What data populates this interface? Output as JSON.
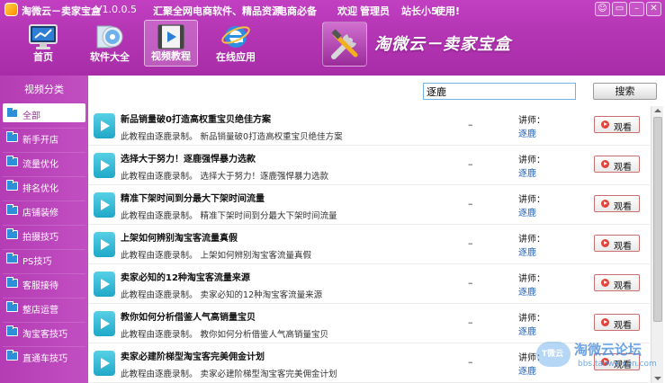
{
  "titlebar": {
    "app_name": "淘微云－卖家宝盒",
    "version": "V1.0.0.5",
    "slogan": "汇聚全网电商软件、精品资源",
    "slogan2": "电商必备",
    "welcome": "欢迎",
    "user": "管理员",
    "member": "站长小5",
    "use": "使用!",
    "buttons": [
      "☺",
      "▭",
      "–",
      "✕"
    ]
  },
  "nav": [
    {
      "label": "首页"
    },
    {
      "label": "软件大全"
    },
    {
      "label": "视频教程",
      "active": true
    },
    {
      "label": "在线应用"
    }
  ],
  "banner": {
    "title": "淘微云－卖家宝盒"
  },
  "sidebar": {
    "title": "视频分类",
    "items": [
      {
        "label": "全部",
        "active": true
      },
      {
        "label": "新手开店"
      },
      {
        "label": "流量优化"
      },
      {
        "label": "排名优化"
      },
      {
        "label": "店铺装修"
      },
      {
        "label": "拍摄技巧"
      },
      {
        "label": "PS技巧"
      },
      {
        "label": "客服接待"
      },
      {
        "label": "整店运营"
      },
      {
        "label": "淘宝客技巧"
      },
      {
        "label": "直通车技巧"
      }
    ]
  },
  "search": {
    "value": "逐鹿",
    "button": "搜索"
  },
  "videos": [
    {
      "title": "新品销量破0打造高权重宝贝绝佳方案",
      "desc": "此教程由逐鹿录制。 新品销量破0打造高权重宝贝绝佳方案",
      "dash": "–",
      "lecturer_label": "讲师：",
      "lecturer": "逐鹿",
      "watch": "观看"
    },
    {
      "title": "选择大于努力！逐鹿强悍暴力选款",
      "desc": "此教程由逐鹿录制。 选择大于努力！逐鹿强悍暴力选款",
      "dash": "–",
      "lecturer_label": "讲师：",
      "lecturer": "逐鹿",
      "watch": "观看"
    },
    {
      "title": "精准下架时间到分最大下架时间流量",
      "desc": "此教程由逐鹿录制。 精准下架时间到分最大下架时间流量",
      "dash": "–",
      "lecturer_label": "讲师：",
      "lecturer": "逐鹿",
      "watch": "观看"
    },
    {
      "title": "上架如何辨别淘宝客流量真假",
      "desc": "此教程由逐鹿录制。 上架如何辨别淘宝客流量真假",
      "dash": "–",
      "lecturer_label": "讲师：",
      "lecturer": "逐鹿",
      "watch": "观看"
    },
    {
      "title": "卖家必知的12种淘宝客流量来源",
      "desc": "此教程由逐鹿录制。 卖家必知的12种淘宝客流量来源",
      "dash": "–",
      "lecturer_label": "讲师：",
      "lecturer": "逐鹿",
      "watch": "观看"
    },
    {
      "title": "教你如何分析借鉴人气高销量宝贝",
      "desc": "此教程由逐鹿录制。 教你如何分析借鉴人气高销量宝贝",
      "dash": "–",
      "lecturer_label": "讲师：",
      "lecturer": "逐鹿",
      "watch": "观看"
    },
    {
      "title": "卖家必建阶梯型淘宝客完美佣金计划",
      "desc": "此教程由逐鹿录制。 卖家必建阶梯型淘宝客完美佣金计划",
      "dash": "–",
      "lecturer_label": "讲师：",
      "lecturer": "逐鹿",
      "watch": "观看"
    }
  ],
  "watermark": {
    "logo": "T微云",
    "text": "淘微云论坛",
    "url": "bbs.taoweiyun.com"
  },
  "colors": {
    "header": "#b536b5",
    "sidebar": "#c24fc2",
    "play": "#2fb5d2",
    "lecturer": "#1f5fb5",
    "watch_border": "#c87070"
  }
}
